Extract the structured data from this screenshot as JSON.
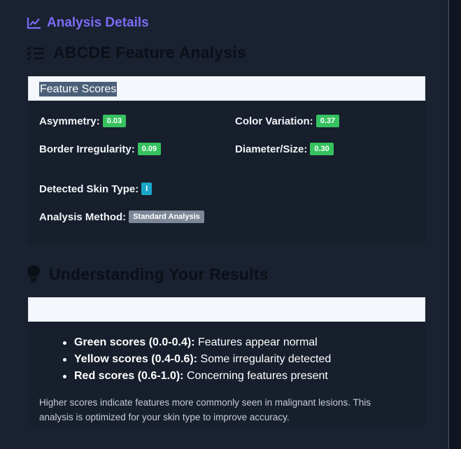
{
  "section": {
    "title": "Analysis Details",
    "icon": "line-chart-icon"
  },
  "abcde": {
    "heading": "ABCDE Feature Analysis",
    "icon": "checklist-icon",
    "card_header": "Feature Scores",
    "scores": {
      "asymmetry": {
        "label": "Asymmetry:",
        "value": "0.03"
      },
      "border": {
        "label": "Border Irregularity:",
        "value": "0.09"
      },
      "color": {
        "label": "Color Variation:",
        "value": "0.37"
      },
      "diameter": {
        "label": "Diameter/Size:",
        "value": "0.30"
      }
    },
    "skin_type": {
      "label": "Detected Skin Type:",
      "value": "I"
    },
    "method": {
      "label": "Analysis Method:",
      "value": "Standard Analysis"
    }
  },
  "understanding": {
    "heading": "Understanding Your Results",
    "icon": "lightbulb-icon",
    "items": [
      {
        "term": "Green scores (0.0-0.4):",
        "desc": " Features appear normal"
      },
      {
        "term": "Yellow scores (0.4-0.6):",
        "desc": " Some irregularity detected"
      },
      {
        "term": "Red scores (0.6-1.0):",
        "desc": " Concerning features present"
      }
    ],
    "note": "Higher scores indicate features more commonly seen in malignant lesions. This analysis is optimized for your skin type to improve accuracy."
  },
  "colors": {
    "accent": "#7b6cf6",
    "badge_green": "#35c25f",
    "badge_cyan": "#1ba6c9",
    "badge_grey": "#7d8797"
  }
}
